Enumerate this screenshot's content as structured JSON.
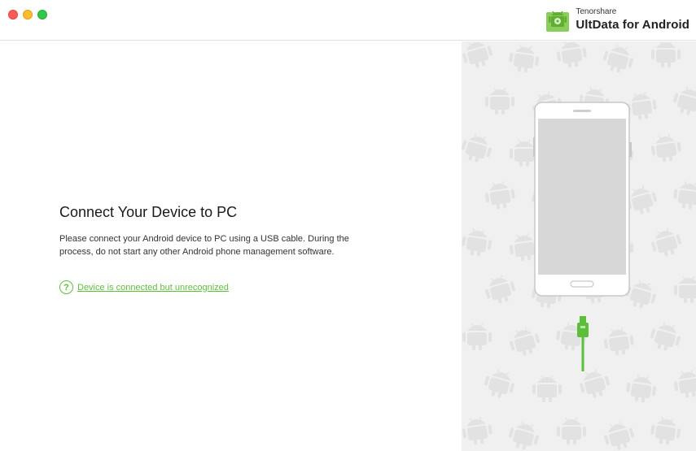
{
  "window": {
    "controls": [
      "close",
      "minimize",
      "zoom"
    ],
    "colors": {
      "close": "#fc5b57",
      "minimize": "#fdbc2e",
      "zoom": "#33c748"
    }
  },
  "brand": {
    "company": "Tenorshare",
    "product": "UltData for Android",
    "logo_icon": "android-logo-icon",
    "accent": "#5cbf3a"
  },
  "main": {
    "heading": "Connect Your Device to PC",
    "description": "Please connect your Android device to PC using a USB cable. During the process, do not start any other Android phone management software.",
    "help_link": {
      "icon": "question-circle-icon",
      "label": "Device is connected but unrecognized"
    }
  },
  "illustration": {
    "icons": [
      "android-pattern",
      "smartphone-icon",
      "usb-cable-icon"
    ],
    "accent": "#5cbf3a"
  }
}
